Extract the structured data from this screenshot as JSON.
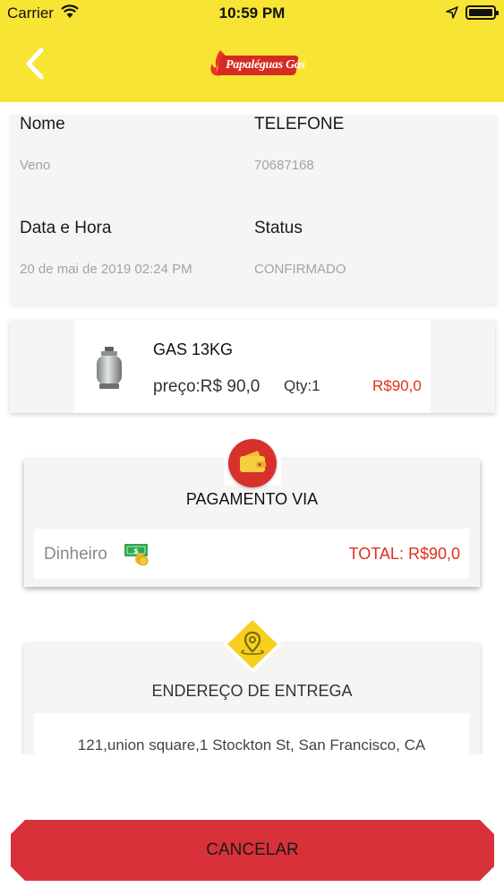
{
  "status_bar": {
    "carrier": "Carrier",
    "time": "10:59 PM"
  },
  "header": {
    "logo_text": "Papaléguas Gás"
  },
  "order": {
    "name_label": "Nome",
    "name_value": "Veno",
    "phone_label": "TELEFONE",
    "phone_value": "70687168",
    "datetime_label": "Data e Hora",
    "datetime_value": "20 de mai de 2019 02:24 PM",
    "status_label": "Status",
    "status_value": "CONFIRMADO"
  },
  "product": {
    "name": "GAS 13KG",
    "price": "preço:R$ 90,0",
    "qty": "Qty:1",
    "total": "R$90,0"
  },
  "payment": {
    "title": "PAGAMENTO VIA",
    "method": "Dinheiro",
    "total": "TOTAL: R$90,0"
  },
  "delivery": {
    "title": "ENDEREÇO DE ENTREGA",
    "address": "121,union square,1 Stockton St, San Francisco, CA"
  },
  "actions": {
    "cancel_label": "CANCELAR"
  },
  "colors": {
    "header_yellow": "#f8e533",
    "accent_red": "#e0301e",
    "button_red": "#d8313a",
    "card_bg": "#f6f5f4"
  },
  "icons": [
    "back-chevron-icon",
    "wifi-icon",
    "location-arrow-icon",
    "battery-icon",
    "gas-cylinder-icon",
    "wallet-icon",
    "cash-icon",
    "location-pin-icon"
  ]
}
